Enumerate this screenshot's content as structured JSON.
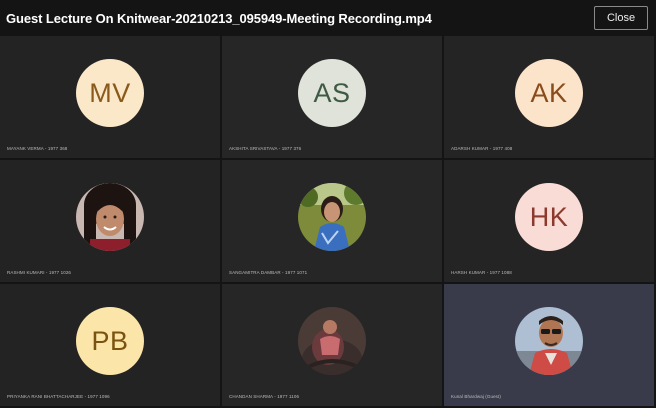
{
  "window": {
    "title": "Guest Lecture On Knitwear-20210213_095949-Meeting Recording.mp4",
    "close_label": "Close"
  },
  "participants": [
    {
      "initials": "MV",
      "name": "MAYANK VERMA - 1977 368",
      "type": "initials",
      "color": "#fbe8c8"
    },
    {
      "initials": "AS",
      "name": "AKSHITA SRIVASTAVA - 1977 376",
      "type": "initials",
      "color": "#dfe3d9"
    },
    {
      "initials": "AK",
      "name": "ADARSH KUMAR - 1977 408",
      "type": "initials",
      "color": "#fbe4ca"
    },
    {
      "initials": "",
      "name": "RASHMI KUMARI - 1977 1026",
      "type": "photo",
      "icon": "woman-portrait-photo"
    },
    {
      "initials": "",
      "name": "SANGAMITRA DAMBAR - 1977 1071",
      "type": "photo",
      "icon": "woman-outdoor-photo"
    },
    {
      "initials": "HK",
      "name": "HARSH KUMAR - 1977 1088",
      "type": "initials",
      "color": "#f9dcd5"
    },
    {
      "initials": "PB",
      "name": "PRIYANKA RANI BHATTACHARJEE - 1977 1096",
      "type": "initials",
      "color": "#fbe5a8"
    },
    {
      "initials": "",
      "name": "CHANDAN SHARMA - 1977 1106",
      "type": "photo",
      "icon": "person-sitting-photo"
    },
    {
      "initials": "",
      "name": "Kunal Bhardwaj (Guest)",
      "type": "photo",
      "icon": "man-sunglasses-photo"
    }
  ]
}
